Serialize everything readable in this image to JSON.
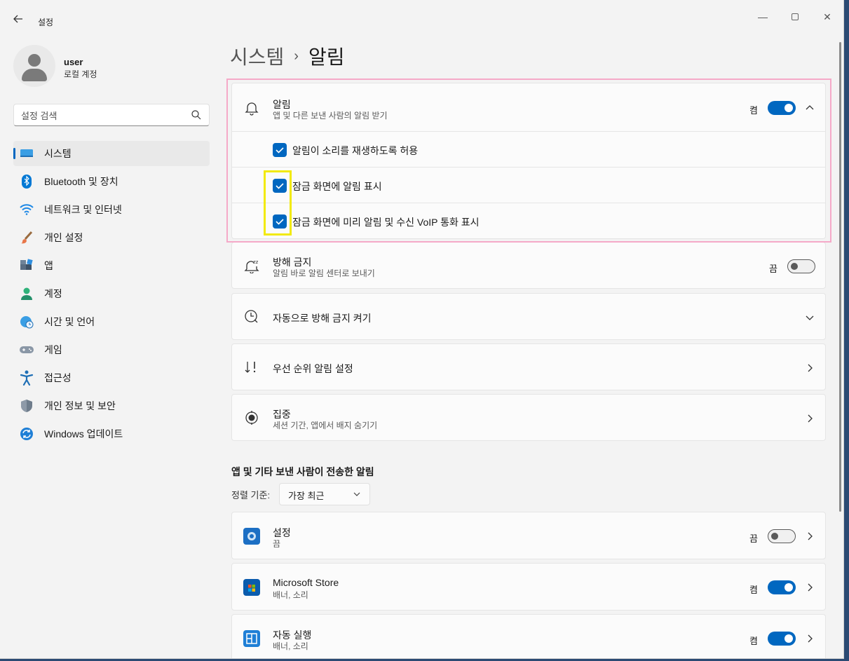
{
  "window": {
    "title": "설정",
    "controls": {
      "minimize": "—",
      "close": "✕"
    }
  },
  "profile": {
    "name": "user",
    "type": "로컬 계정"
  },
  "search": {
    "placeholder": "설정 검색"
  },
  "nav": {
    "items": [
      {
        "label": "시스템",
        "icon": "system-icon",
        "active": true
      },
      {
        "label": "Bluetooth 및 장치",
        "icon": "bluetooth-icon"
      },
      {
        "label": "네트워크 및 인터넷",
        "icon": "wifi-icon"
      },
      {
        "label": "개인 설정",
        "icon": "brush-icon"
      },
      {
        "label": "앱",
        "icon": "apps-icon"
      },
      {
        "label": "계정",
        "icon": "account-icon"
      },
      {
        "label": "시간 및 언어",
        "icon": "globe-clock-icon"
      },
      {
        "label": "게임",
        "icon": "gamepad-icon"
      },
      {
        "label": "접근성",
        "icon": "accessibility-icon"
      },
      {
        "label": "개인 정보 및 보안",
        "icon": "shield-icon"
      },
      {
        "label": "Windows 업데이트",
        "icon": "update-icon"
      }
    ]
  },
  "breadcrumb": {
    "parent": "시스템",
    "separator": "›",
    "current": "알림"
  },
  "notifications": {
    "title": "알림",
    "subtitle": "앱 및 다른 보낸 사람의 알림 받기",
    "toggle_state": "켬",
    "enabled": true,
    "options": [
      {
        "label": "알림이 소리를 재생하도록 허용",
        "checked": true
      },
      {
        "label": "잠금 화면에 알림 표시",
        "checked": true
      },
      {
        "label": "잠금 화면에 미리 알림 및 수신 VoIP 통화 표시",
        "checked": true
      }
    ]
  },
  "dnd": {
    "title": "방해 금지",
    "subtitle": "알림 바로 알림 센터로 보내기",
    "toggle_state": "끔",
    "enabled": false
  },
  "auto_dnd": {
    "title": "자동으로 방해 금지 켜기"
  },
  "priority": {
    "title": "우선 순위 알림 설정"
  },
  "focus": {
    "title": "집중",
    "subtitle": "세션 기간, 앱에서 배지 숨기기"
  },
  "apps_section": {
    "title": "앱 및 기타 보낸 사람이 전송한 알림",
    "sort_label": "정렬 기준:",
    "sort_value": "가장 최근",
    "apps": [
      {
        "name": "설정",
        "sub": "끔",
        "toggle_state": "끔",
        "enabled": false,
        "icon": "settings-gear-icon"
      },
      {
        "name": "Microsoft Store",
        "sub": "배너, 소리",
        "toggle_state": "켬",
        "enabled": true,
        "icon": "store-icon"
      },
      {
        "name": "자동 실행",
        "sub": "배너, 소리",
        "toggle_state": "켬",
        "enabled": true,
        "icon": "autoplay-icon"
      }
    ]
  },
  "colors": {
    "accent": "#0067c0",
    "highlight_pink": "#f5a9c8",
    "highlight_yellow": "#f2ea0b"
  }
}
